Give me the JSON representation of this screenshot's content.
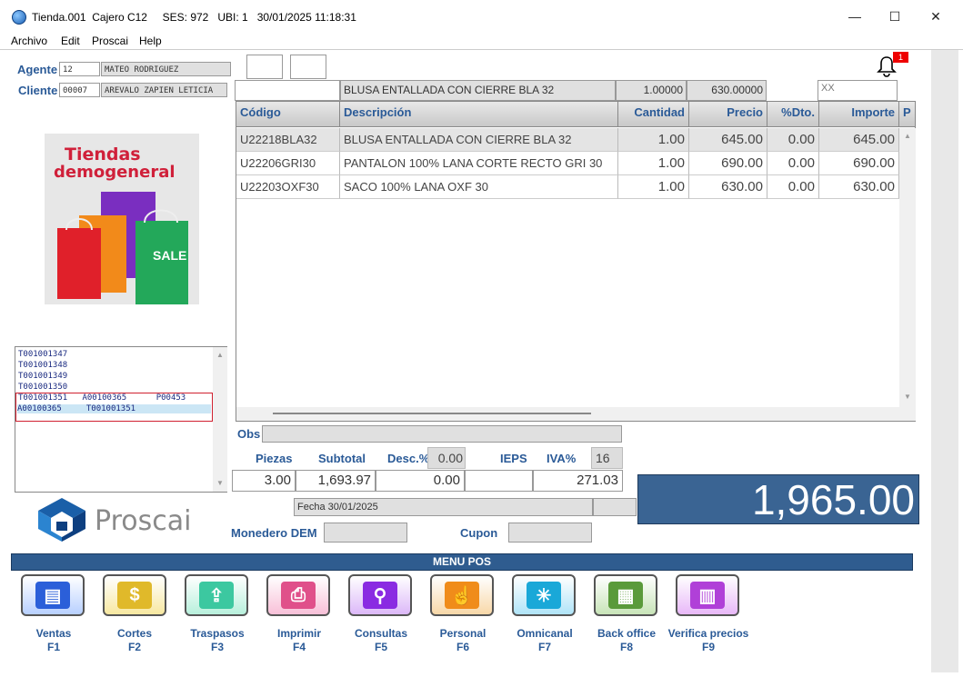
{
  "window": {
    "title": "Tienda.001  Cajero C12     SES: 972   UBI: 1   30/01/2025 11:18:31",
    "minimize": "—",
    "maximize": "☐",
    "close": "✕"
  },
  "menubar": [
    "Archivo",
    "Edit",
    "Proscai",
    "Help"
  ],
  "header": {
    "agente_label": "Agente",
    "agente_code": "12",
    "agente_name": "MATEO RODRIGUEZ",
    "cliente_label": "Cliente",
    "cliente_code": "00007",
    "cliente_name": "AREVALO ZAPIEN LETICIA",
    "notif_count": "1"
  },
  "promo": {
    "text1": "Tiendas",
    "text2": "demogeneral",
    "sale": "SALE"
  },
  "entry": {
    "code": "",
    "description": "BLUSA ENTALLADA CON CIERRE BLA 32",
    "quantity": "1.00000",
    "price": "630.00000",
    "extra": "XX"
  },
  "grid": {
    "headers": [
      "Código",
      "Descripción",
      "Cantidad",
      "Precio",
      "%Dto.",
      "Importe",
      "P"
    ],
    "rows": [
      {
        "code": "U22218BLA32",
        "desc": "BLUSA ENTALLADA CON CIERRE BLA 32",
        "qty": "1.00",
        "price": "645.00",
        "dto": "0.00",
        "imp": "645.00"
      },
      {
        "code": "U22206GRI30",
        "desc": "PANTALON 100% LANA  CORTE RECTO GRI 30",
        "qty": "1.00",
        "price": "690.00",
        "dto": "0.00",
        "imp": "690.00"
      },
      {
        "code": "U22203OXF30",
        "desc": "SACO 100% LANA OXF 30",
        "qty": "1.00",
        "price": "630.00",
        "dto": "0.00",
        "imp": "630.00"
      }
    ]
  },
  "tickets": [
    "T001001347",
    "T001001348",
    "T001001349",
    "T001001350",
    "T001001351   A00100365      P00453",
    "A00100365     T001001351"
  ],
  "totals": {
    "obs_label": "Obs",
    "obs": "",
    "piezas_label": "Piezas",
    "subtotal_label": "Subtotal",
    "desc_label": "Desc.%",
    "desc_pct": "0.00",
    "ieps_label": "IEPS",
    "iva_label": "IVA%",
    "iva_pct": "16",
    "piezas": "3.00",
    "subtotal": "1,693.97",
    "desc": "0.00",
    "ieps": "",
    "iva": "271.03",
    "total": "1,965.00",
    "fecha": "Fecha 30/01/2025",
    "monedero_label": "Monedero DEM",
    "cupon_label": "Cupon"
  },
  "logo": {
    "text": "Proscai"
  },
  "menu_pos": {
    "title": "MENU POS",
    "buttons": [
      {
        "label": "Ventas",
        "key": "F1",
        "color": "#2b5fd9"
      },
      {
        "label": "Cortes",
        "key": "F2",
        "color": "#e0b92a"
      },
      {
        "label": "Traspasos",
        "key": "F3",
        "color": "#3cc8a0"
      },
      {
        "label": "Imprimir",
        "key": "F4",
        "color": "#e0508a"
      },
      {
        "label": "Consultas",
        "key": "F5",
        "color": "#8a2be2"
      },
      {
        "label": "Personal",
        "key": "F6",
        "color": "#f08c1a"
      },
      {
        "label": "Omnicanal",
        "key": "F7",
        "color": "#1aa8d8"
      },
      {
        "label": "Back office",
        "key": "F8",
        "color": "#5a9a3a"
      },
      {
        "label": "Verifica precios",
        "key": "F9",
        "color": "#b040d8"
      }
    ]
  }
}
